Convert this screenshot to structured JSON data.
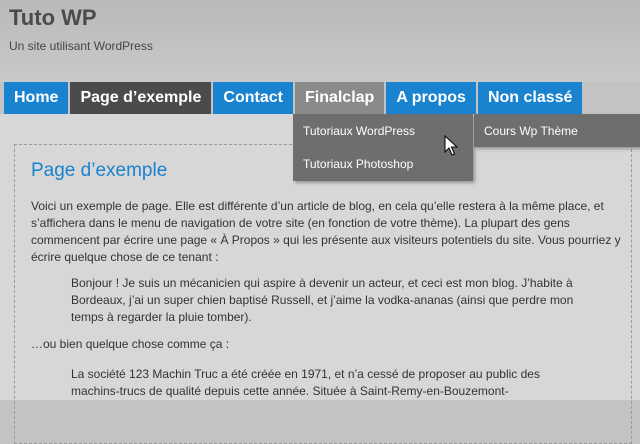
{
  "site": {
    "title": "Tuto WP",
    "tagline": "Un site utilisant WordPress"
  },
  "nav": {
    "items": [
      {
        "label": "Home"
      },
      {
        "label": "Page d’exemple"
      },
      {
        "label": "Contact"
      },
      {
        "label": "Finalclap"
      },
      {
        "label": "A propos"
      },
      {
        "label": "Non classé"
      }
    ],
    "current": "Page d’exemple",
    "hovered": "Finalclap"
  },
  "submenus": {
    "finalclap": [
      "Tutoriaux WordPress",
      "Tutoriaux Photoshop"
    ],
    "non_classe": [
      "Cours Wp Thème"
    ]
  },
  "page": {
    "heading": "Page d’exemple",
    "paragraphs": [
      "Voici un exemple de page. Elle est différente d’un article de blog, en cela qu’elle restera à la même place, et s’affichera dans le menu de navigation de votre site (en fonction de votre thème). La plupart des gens commencent par écrire une page « À Propos » qui les présente aux visiteurs potentiels du site. Vous pourriez y écrire quelque chose de ce tenant :",
      "…ou bien quelque chose comme ça :"
    ],
    "quotes": [
      "Bonjour ! Je suis un mécanicien qui aspire à devenir un acteur, et ceci est mon blog. J’habite à Bordeaux, j’ai un super chien baptisé Russell, et j’aime la vodka-ananas (ainsi que perdre mon temps à regarder la pluie tomber).",
      "La société 123 Machin Truc a été créée en 1971, et n’a cessé de proposer au public des machins-trucs de qualité depuis cette année. Située à Saint-Remy-en-Bouzemont-"
    ]
  },
  "colors": {
    "accent": "#1a83cf",
    "nav_current": "#4b4b4b",
    "nav_hover": "#8a8a8a",
    "submenu_bg": "#6e6e6e"
  }
}
